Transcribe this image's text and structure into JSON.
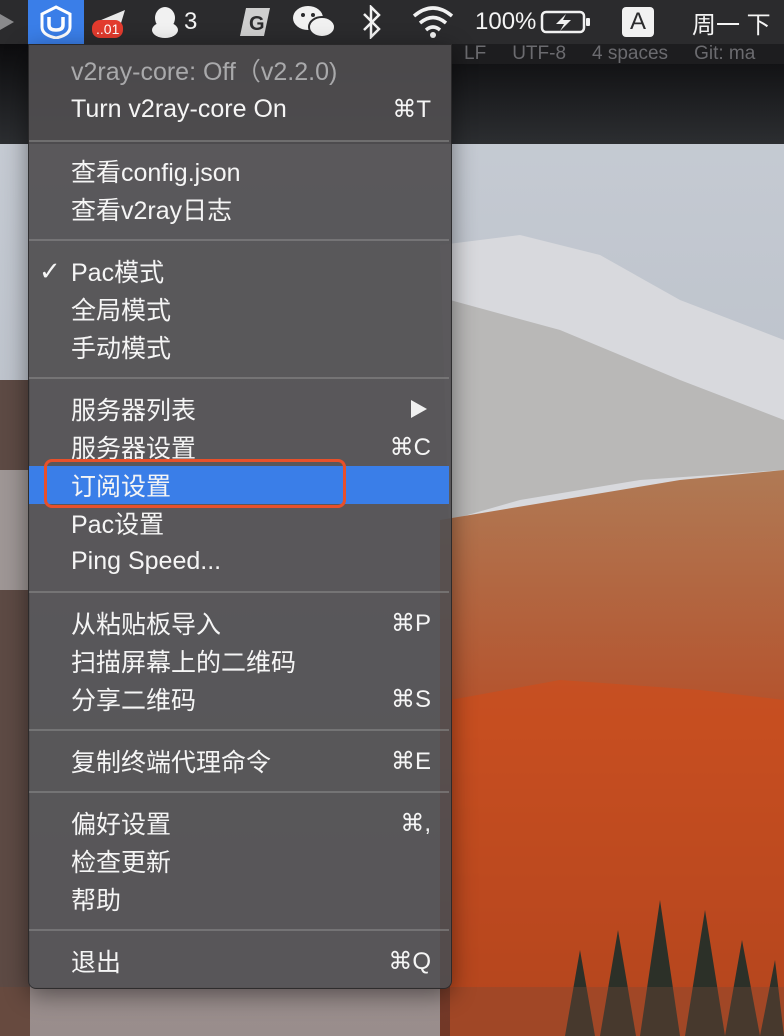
{
  "menubar": {
    "badge": "..01",
    "qq_count": "3",
    "battery": "100%",
    "input_method": "A",
    "date": "周一 下"
  },
  "editor_status": [
    "LF",
    "UTF-8",
    "4 spaces",
    "Git: ma"
  ],
  "menu": {
    "status": "v2ray-core: Off（v2.2.0)",
    "toggle": {
      "label": "Turn v2ray-core On",
      "shortcut": "⌘T"
    },
    "view_config": "查看config.json",
    "view_log": "查看v2ray日志",
    "pac_mode": "Pac模式",
    "global_mode": "全局模式",
    "manual_mode": "手动模式",
    "server_list": "服务器列表",
    "server_settings": {
      "label": "服务器设置",
      "shortcut": "⌘C"
    },
    "subscription": "订阅设置",
    "pac_settings": "Pac设置",
    "ping_speed": "Ping Speed...",
    "import_clipboard": {
      "label": "从粘贴板导入",
      "shortcut": "⌘P"
    },
    "scan_qr": "扫描屏幕上的二维码",
    "share_qr": {
      "label": "分享二维码",
      "shortcut": "⌘S"
    },
    "copy_proxy_cmd": {
      "label": "复制终端代理命令",
      "shortcut": "⌘E"
    },
    "preferences": {
      "label": "偏好设置",
      "shortcut": "⌘,"
    },
    "check_updates": "检查更新",
    "help": "帮助",
    "quit": {
      "label": "退出",
      "shortcut": "⌘Q"
    }
  },
  "colors": {
    "highlight": "#3a7ee8",
    "focus_ring": "#e8502a",
    "menubar_bg": "#2b2b2d"
  }
}
